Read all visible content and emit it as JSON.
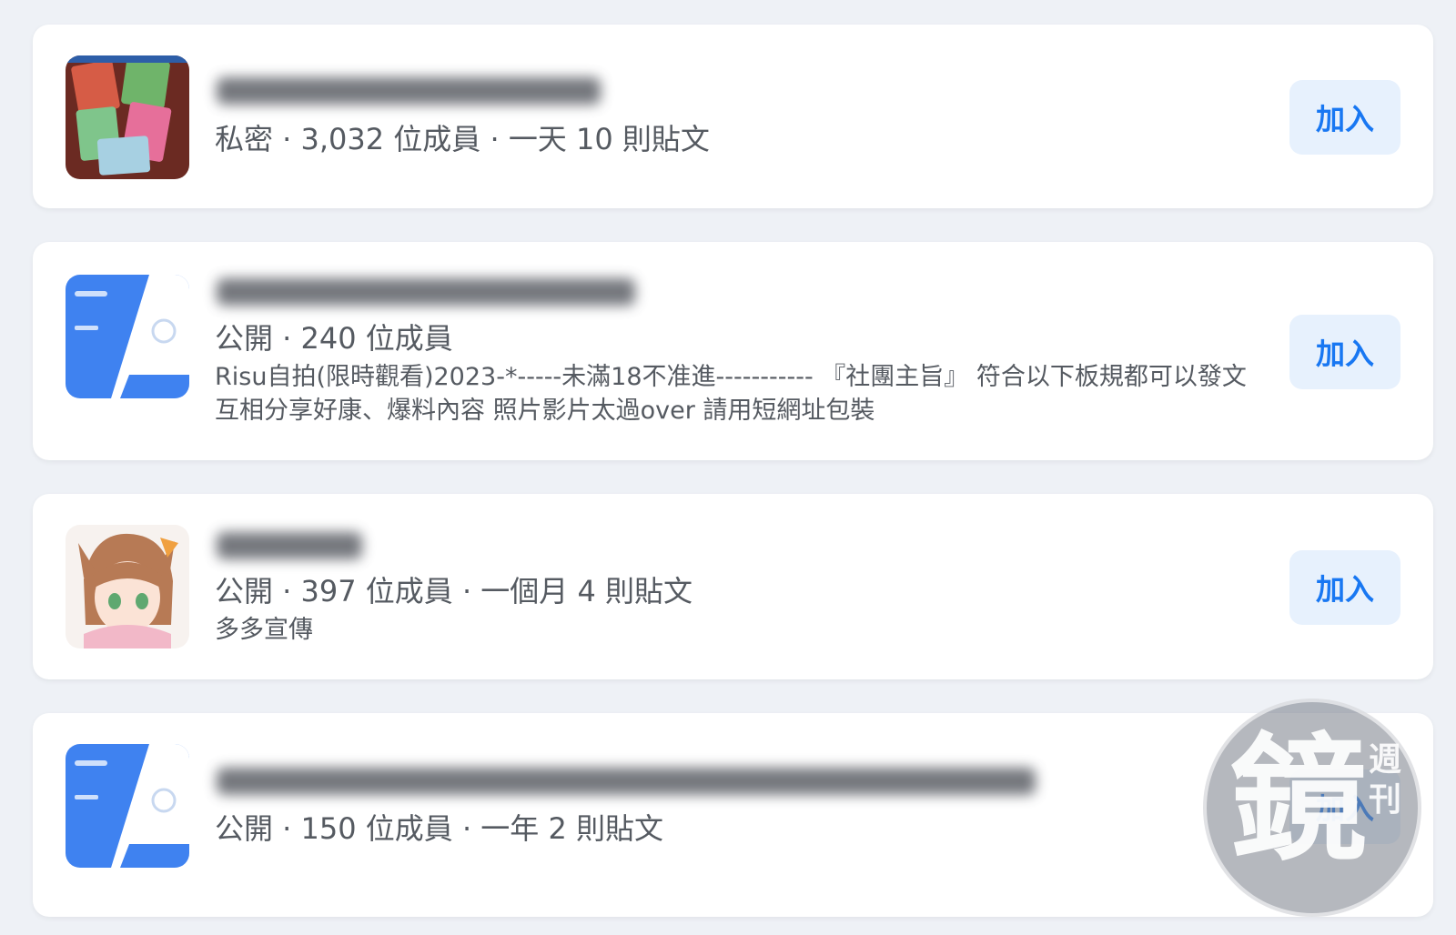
{
  "groups": [
    {
      "meta": "私密 · 3,032 位成員 · 一天 10 則貼文",
      "description": "",
      "join_label": "加入"
    },
    {
      "meta": "公開 · 240 位成員",
      "description": "Risu自拍(限時觀看)2023-*-----未滿18不准進----------- 『社團主旨』 符合以下板規都可以發文 互相分享好康、爆料內容 照片影片太過over 請用短網址包裝",
      "join_label": "加入"
    },
    {
      "meta": "公開 · 397 位成員 · 一個月 4 則貼文",
      "description": "多多宣傳",
      "join_label": "加入"
    },
    {
      "meta": "公開 · 150 位成員 · 一年 2 則貼文",
      "description": "",
      "join_label": "加入"
    }
  ],
  "watermark": {
    "glyph": "鏡",
    "side": "週刊"
  },
  "colors": {
    "accent": "#1877f2",
    "button_bg": "#e7f1fd",
    "page_bg": "#eef1f6"
  }
}
